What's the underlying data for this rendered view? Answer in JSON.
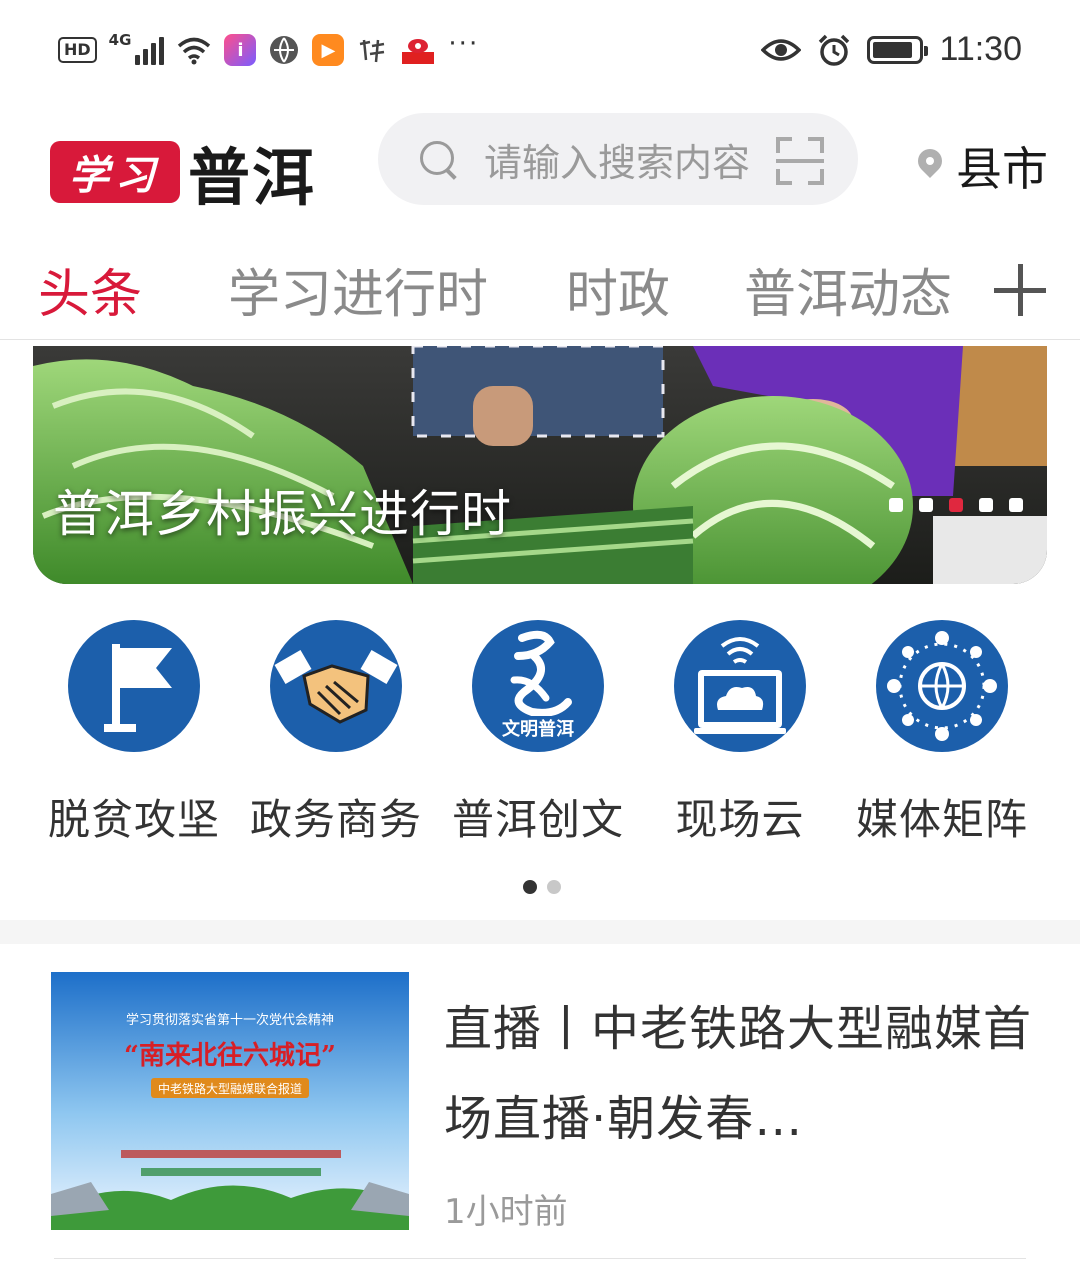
{
  "status_bar": {
    "hd": "HD",
    "network": "4G",
    "time": "11:30",
    "ellipsis": "···"
  },
  "header": {
    "logo_mark": "学习",
    "logo_text": "普洱",
    "search_placeholder": "请输入搜索内容",
    "region": "县市"
  },
  "tabs": [
    {
      "label": "头条",
      "active": true
    },
    {
      "label": "学习进行时",
      "active": false
    },
    {
      "label": "时政",
      "active": false
    },
    {
      "label": "普洱动态",
      "active": false
    }
  ],
  "banner": {
    "caption": "普洱乡村振兴进行时",
    "slide_count": 5,
    "active_slide": 2
  },
  "quick_menu": [
    {
      "label": "脱贫攻坚",
      "icon": "flag-icon"
    },
    {
      "label": "政务商务",
      "icon": "handshake-icon"
    },
    {
      "label": "普洱创文",
      "icon": "wenming-icon",
      "badge": "文明普洱"
    },
    {
      "label": "现场云",
      "icon": "cloud-monitor-icon"
    },
    {
      "label": "媒体矩阵",
      "icon": "globe-network-icon"
    }
  ],
  "quick_menu_pages": {
    "count": 2,
    "active": 0
  },
  "news": [
    {
      "title": "直播丨中老铁路大型融媒首场直播·朝发春…",
      "time": "1小时前",
      "thumb": {
        "line1": "学习贯彻落实省第十一次党代会精神",
        "line2": "“南来北往六城记”",
        "line3": "中老铁路大型融媒联合报道"
      }
    }
  ],
  "colors": {
    "brand_red": "#d8193a",
    "icon_blue": "#1c5fab",
    "tab_inactive": "#8a8a8a"
  }
}
